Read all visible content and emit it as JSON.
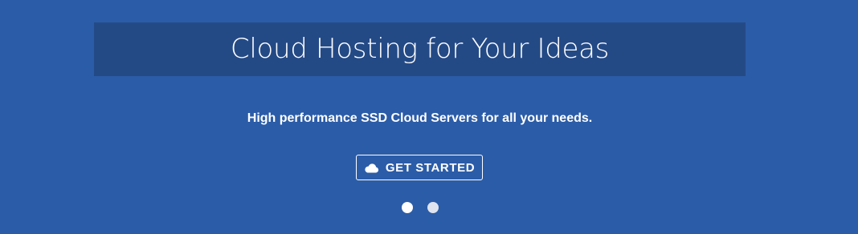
{
  "hero": {
    "title": "Cloud Hosting for Your Ideas",
    "subtitle": "High performance SSD Cloud Servers for all your needs.",
    "cta_label": "GET STARTED",
    "cta_icon": "cloud-icon",
    "slides": [
      {
        "active": true
      },
      {
        "active": false
      }
    ]
  },
  "colors": {
    "background": "#2b5ca8",
    "title_band": "#244a86",
    "text": "#ffffff"
  }
}
